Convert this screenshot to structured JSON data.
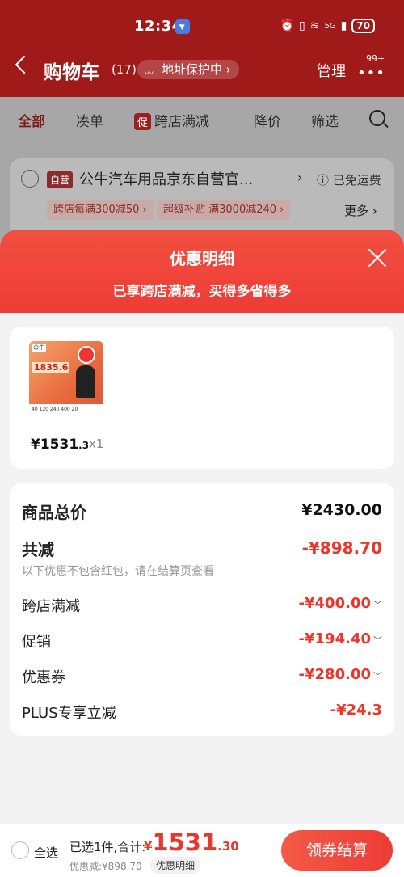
{
  "status_bar": {
    "time": "12:34",
    "network": "5G",
    "battery": "70"
  },
  "header": {
    "title": "购物车",
    "count": "(17)",
    "address_protect": "地址保护中 ›",
    "manage": "管理",
    "more_badge": "99+"
  },
  "tabs": [
    {
      "label": "全部"
    },
    {
      "label": "凑单"
    },
    {
      "label": "跨店满减",
      "tag": "促"
    },
    {
      "label": "降价"
    },
    {
      "label": "筛选"
    }
  ],
  "store": {
    "badge": "自营",
    "name": "公牛汽车用品京东自营官...",
    "arrow": "›",
    "shipping": "ⓘ 已免运费",
    "chips": [
      "跨店每满300减50 ›",
      "超级补贴 满3000减240 ›"
    ],
    "more": "更多 ›"
  },
  "sheet": {
    "title": "优惠明细",
    "subtitle": "已享跨店满减，买得多省得多"
  },
  "product": {
    "price_main": "¥1531",
    "price_decimal": ".3",
    "qty": "x1",
    "image": {
      "brand": "公牛",
      "price": "1835.6",
      "strip": "40 120 240 400 20"
    }
  },
  "details": {
    "total_label": "商品总价",
    "total_value": "¥2430.00",
    "reduce_label": "共减",
    "reduce_value": "-¥898.70",
    "note": "以下优惠不包含红包，请在结算页查看",
    "items": [
      {
        "label": "跨店满减",
        "value": "-¥400.00"
      },
      {
        "label": "促销",
        "value": "-¥194.40"
      },
      {
        "label": "优惠券",
        "value": "-¥280.00"
      },
      {
        "label": "PLUS专享立减",
        "value": "-¥24.3"
      }
    ]
  },
  "bottom": {
    "select_all": "全选",
    "chosen": "已选1件,合计:",
    "yen": "¥",
    "total_int": "1531",
    "total_dec": ".30",
    "discount": "优惠减:¥898.70",
    "detail_link": "优惠明细",
    "checkout": "领券结算"
  },
  "colors": {
    "accent": "#ee3a36",
    "header_dimmed": "#a01a1a",
    "price_red": "#e8382d"
  }
}
